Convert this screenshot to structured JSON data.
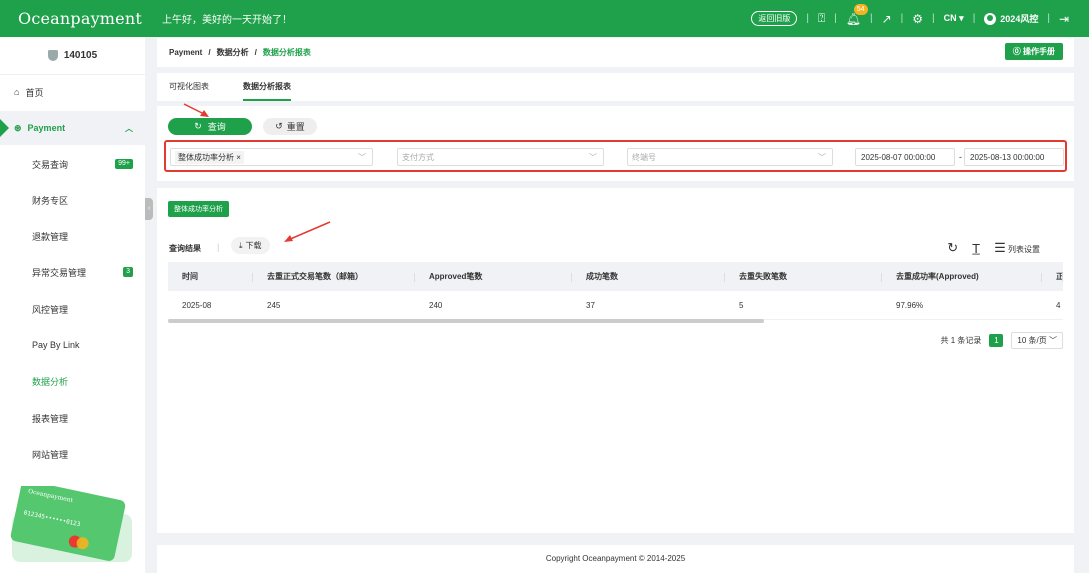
{
  "header": {
    "logo": "Oceanpayment",
    "greeting": "上午好，美好的一天开始了！",
    "old_version_label": "返回旧版",
    "notif_count": "54",
    "language": "CN ▾",
    "user": "2024风控"
  },
  "sidebar": {
    "account_id": "140105",
    "items": [
      {
        "label": "首页",
        "icon": "home-icon"
      },
      {
        "label": "Payment",
        "icon": "payment-icon"
      },
      {
        "label": "交易查询",
        "count": "99+"
      },
      {
        "label": "财务专区"
      },
      {
        "label": "退款管理"
      },
      {
        "label": "异常交易管理",
        "count": "3"
      },
      {
        "label": "风控管理"
      },
      {
        "label": "Pay By Link"
      },
      {
        "label": "数据分析"
      },
      {
        "label": "报表管理"
      },
      {
        "label": "网站管理"
      }
    ],
    "card_number": "012345••••••0123"
  },
  "breadcrumb": {
    "items": [
      "Payment",
      "数据分析",
      "数据分析报表"
    ],
    "sep": "/",
    "manual_label": "⓪ 操作手册"
  },
  "tabs": [
    "可视化图表",
    "数据分析报表"
  ],
  "search": {
    "query_label": "查询",
    "reset_label": "重置",
    "report_type_tag": "整体成功率分析",
    "payment_method_placeholder": "支付方式",
    "terminal_placeholder": "终端号",
    "date_start": "2025-08-07 00:00:00",
    "date_end": "2025-08-13 00:00:00",
    "date_sep": "-"
  },
  "result": {
    "chip_label": "整体成功率分析",
    "title": "查询结果",
    "download_label": "下载",
    "column_settings_label": "列表设置",
    "columns": [
      "时间",
      "去重正式交易笔数（邮箱）",
      "Approved笔数",
      "成功笔数",
      "去重失败笔数",
      "去重成功率(Approved)",
      "正"
    ],
    "rows": [
      [
        "2025-08",
        "245",
        "240",
        "37",
        "5",
        "97.96%",
        "4"
      ]
    ],
    "pagination": {
      "total": "共 1 条记录",
      "page": "1",
      "page_size": "10 条/页"
    }
  },
  "footer": {
    "copyright": "Copyright Oceanpayment © 2014-2025"
  },
  "colors": {
    "brand": "#1fa04b",
    "highlight": "#e23b32",
    "badge": "#f5b320"
  }
}
